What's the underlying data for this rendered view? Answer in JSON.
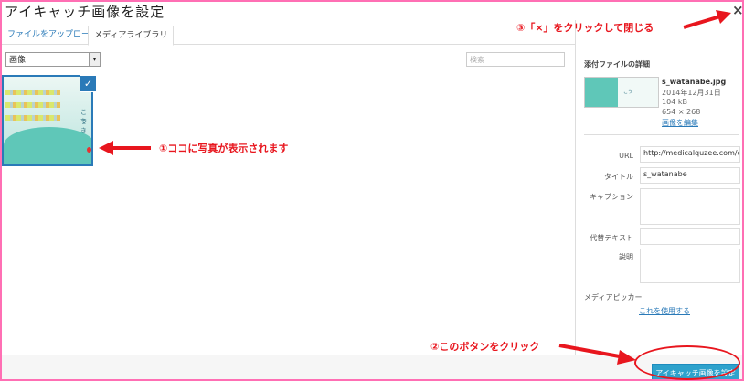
{
  "dialog": {
    "title": "アイキャッチ画像を設定",
    "close": "×"
  },
  "tabs": {
    "upload": "ファイルをアップロード",
    "library": "メディアライブラリ"
  },
  "toolbar": {
    "filter_value": "画像",
    "filter_arrow": "▾",
    "search_placeholder": "検索"
  },
  "attachment": {
    "check": "✓",
    "thumb_text_1": "こう",
    "thumb_text_2": "でき"
  },
  "sidebar": {
    "title": "添付ファイルの詳細",
    "filename": "s_watanabe.jpg",
    "date": "2014年12月31日",
    "filesize": "104 kB",
    "dimensions": "654 × 268",
    "edit_link": "画像を編集",
    "fields": {
      "url_label": "URL",
      "url_value": "http://medicalquzee.com/db",
      "title_label": "タイトル",
      "title_value": "s_watanabe",
      "caption_label": "キャプション",
      "alt_label": "代替テキスト",
      "desc_label": "説明"
    },
    "picker_label": "メディアピッカー",
    "picker_link": "これを使用する"
  },
  "footer": {
    "set_button": "アイキャッチ画像を設定"
  },
  "annotations": {
    "a1": "①ココに写真が表示されます",
    "a2": "②このボタンをクリック",
    "a3": "③「×」をクリックして閉じる"
  },
  "colors": {
    "annotation": "#e8161e",
    "frame": "#ff6fb4",
    "primary_button": "#2ea2cc",
    "link": "#2a7ab8"
  }
}
